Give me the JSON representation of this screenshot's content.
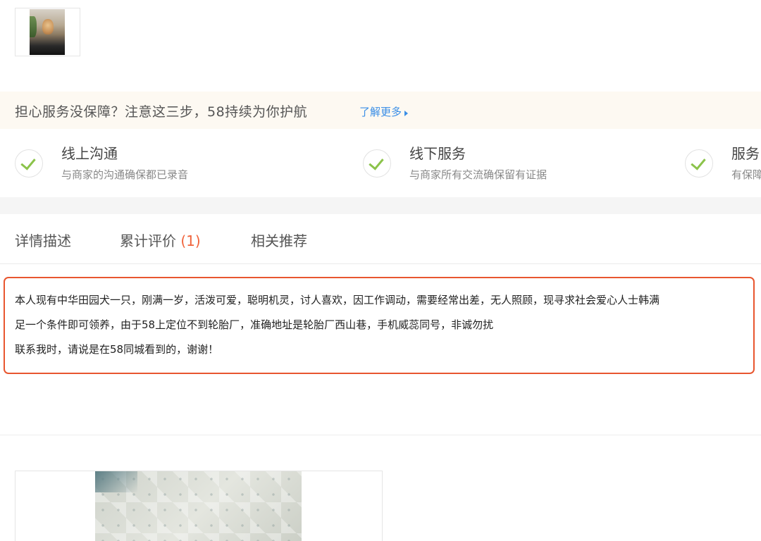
{
  "assurance": {
    "title": "担心服务没保障？注意这三步，58持续为你护航",
    "link_label": "了解更多",
    "steps": [
      {
        "title": "线上沟通",
        "desc": "与商家的沟通确保都已录音"
      },
      {
        "title": "线下服务",
        "desc": "与商家所有交流确保留有证据"
      },
      {
        "title": "服务",
        "desc": "有保障"
      }
    ]
  },
  "tabs": {
    "details": "详情描述",
    "reviews": "累计评价",
    "reviews_count": "(1)",
    "related": "相关推荐"
  },
  "description": {
    "line1": "本人现有中华田园犬一只，刚满一岁，活泼可爱，聪明机灵，讨人喜欢，因工作调动，需要经常出差，无人照顾，现寻求社会爱心人士韩满",
    "line2": "足一个条件即可领养，由于58上定位不到轮胎厂，准确地址是轮胎厂西山巷，手机威蕊同号，非诚勿扰",
    "line3": "联系我时，请说是在58同城看到的，谢谢！"
  },
  "colors": {
    "accent_link": "#3a8ee6",
    "highlight_border": "#e8562f",
    "review_count": "#f0643c",
    "check_green": "#8bc34a"
  }
}
